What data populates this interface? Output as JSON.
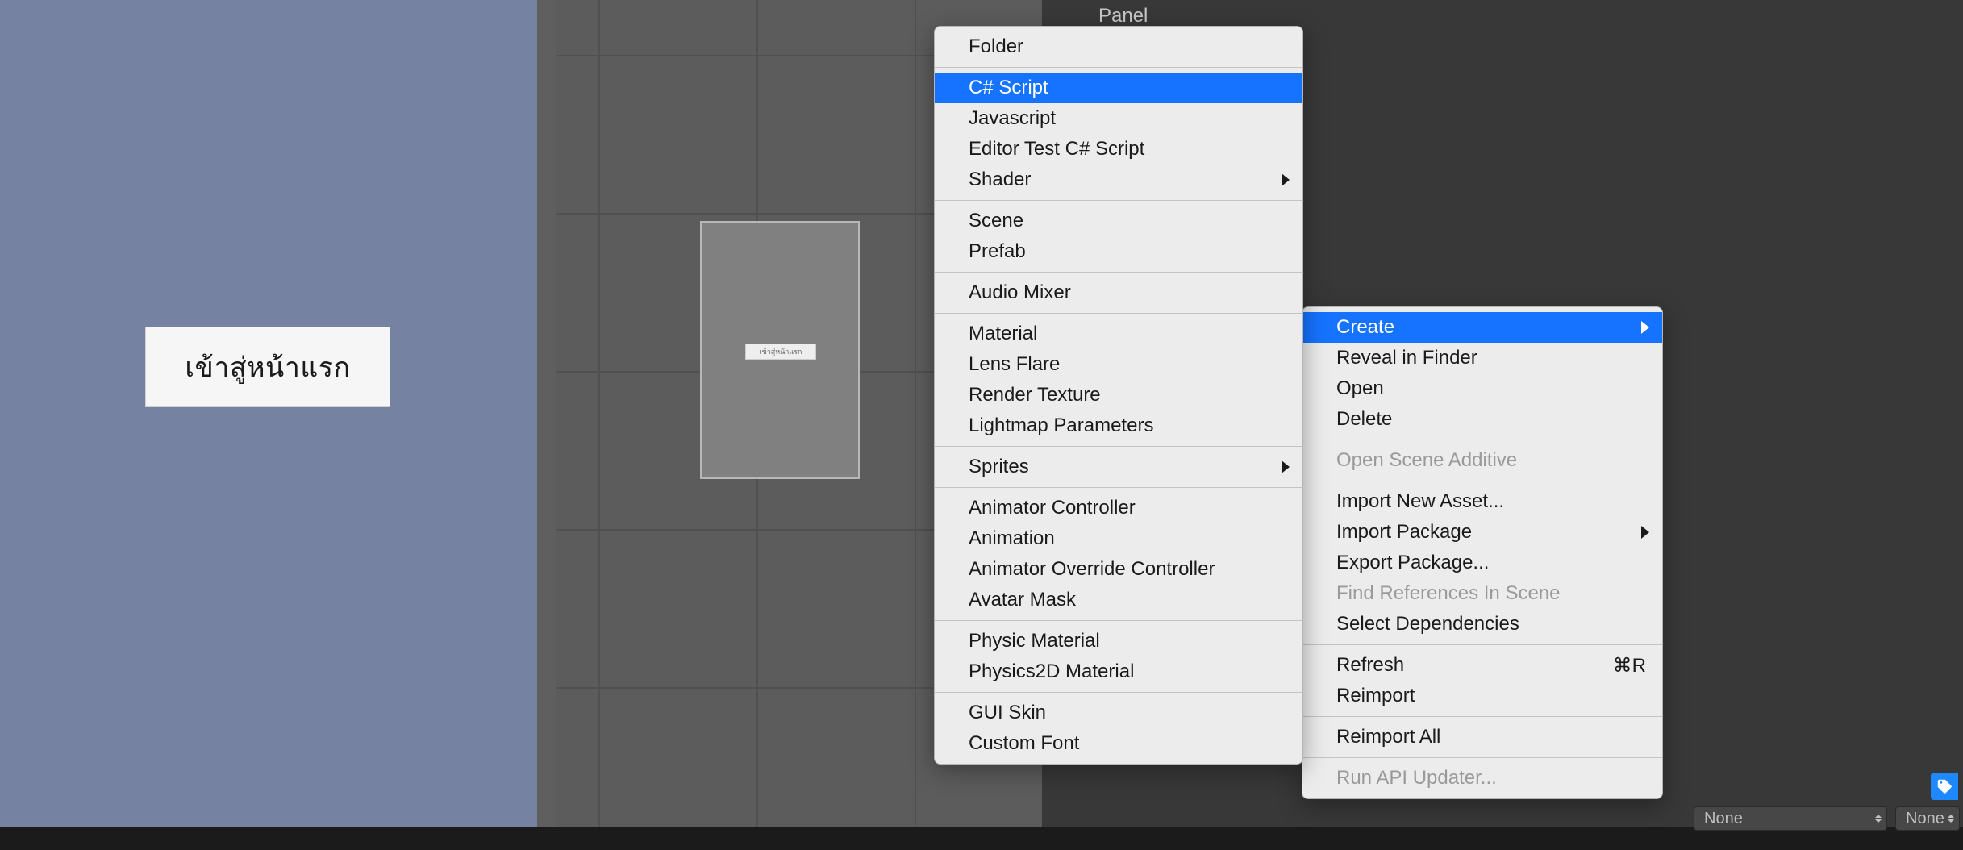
{
  "hierarchy": {
    "selected_label": "Panel"
  },
  "game_preview": {
    "button_label": "เข้าสู่หน้าแรก",
    "mini_label": "เข้าสู่หน้าแรก"
  },
  "bottom_bar": {
    "dropdown1": "None",
    "dropdown2": "None"
  },
  "context_menu_main": {
    "groups": [
      {
        "items": [
          {
            "label": "Create",
            "highlighted": true,
            "submenu": true
          },
          {
            "label": "Reveal in Finder"
          },
          {
            "label": "Open"
          },
          {
            "label": "Delete"
          }
        ]
      },
      {
        "items": [
          {
            "label": "Open Scene Additive",
            "disabled": true
          }
        ]
      },
      {
        "items": [
          {
            "label": "Import New Asset..."
          },
          {
            "label": "Import Package",
            "submenu": true
          },
          {
            "label": "Export Package..."
          },
          {
            "label": "Find References In Scene",
            "disabled": true
          },
          {
            "label": "Select Dependencies"
          }
        ]
      },
      {
        "items": [
          {
            "label": "Refresh",
            "shortcut": "⌘R"
          },
          {
            "label": "Reimport"
          }
        ]
      },
      {
        "items": [
          {
            "label": "Reimport All"
          }
        ]
      },
      {
        "items": [
          {
            "label": "Run API Updater...",
            "disabled": true
          }
        ]
      }
    ]
  },
  "context_menu_create": {
    "groups": [
      {
        "items": [
          {
            "label": "Folder"
          }
        ]
      },
      {
        "items": [
          {
            "label": "C# Script",
            "highlighted": true
          },
          {
            "label": "Javascript"
          },
          {
            "label": "Editor Test C# Script"
          },
          {
            "label": "Shader",
            "submenu": true
          }
        ]
      },
      {
        "items": [
          {
            "label": "Scene"
          },
          {
            "label": "Prefab"
          }
        ]
      },
      {
        "items": [
          {
            "label": "Audio Mixer"
          }
        ]
      },
      {
        "items": [
          {
            "label": "Material"
          },
          {
            "label": "Lens Flare"
          },
          {
            "label": "Render Texture"
          },
          {
            "label": "Lightmap Parameters"
          }
        ]
      },
      {
        "items": [
          {
            "label": "Sprites",
            "submenu": true
          }
        ]
      },
      {
        "items": [
          {
            "label": "Animator Controller"
          },
          {
            "label": "Animation"
          },
          {
            "label": "Animator Override Controller"
          },
          {
            "label": "Avatar Mask"
          }
        ]
      },
      {
        "items": [
          {
            "label": "Physic Material"
          },
          {
            "label": "Physics2D Material"
          }
        ]
      },
      {
        "items": [
          {
            "label": "GUI Skin"
          },
          {
            "label": "Custom Font"
          }
        ]
      }
    ]
  }
}
